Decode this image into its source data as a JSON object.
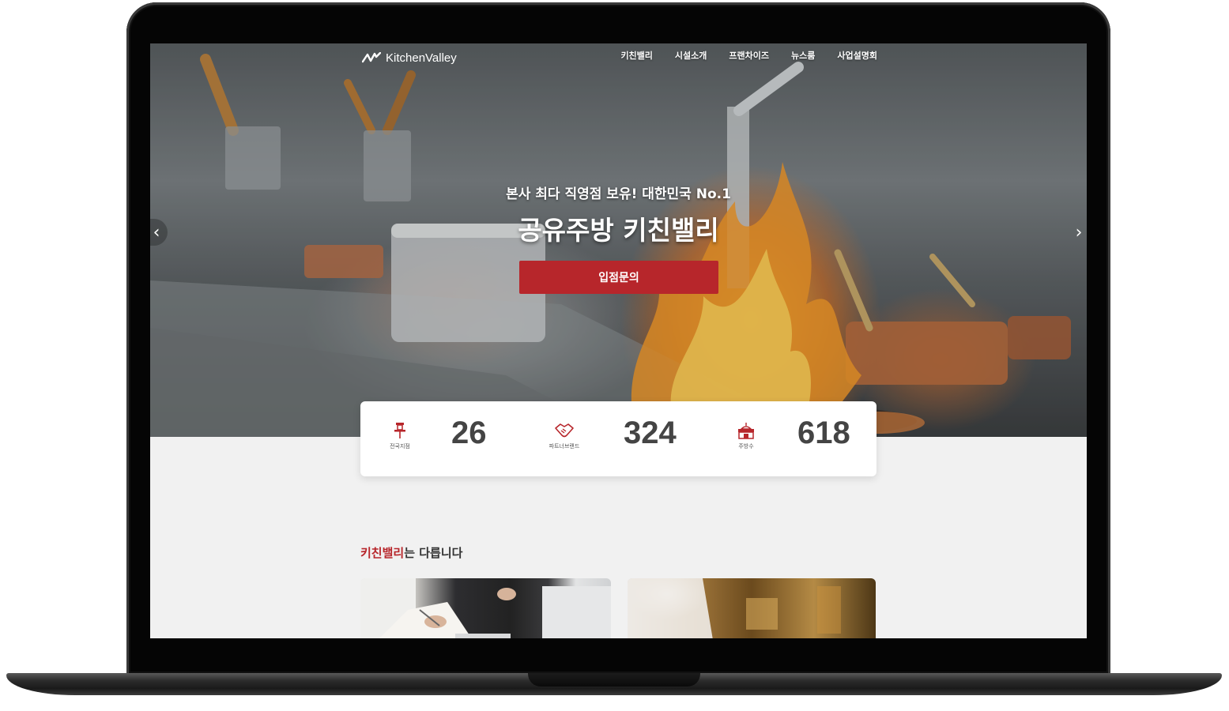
{
  "brand": {
    "name": "KitchenValley"
  },
  "nav": {
    "items": [
      {
        "label": "키친밸리"
      },
      {
        "label": "시설소개"
      },
      {
        "label": "프랜차이즈"
      },
      {
        "label": "뉴스룸"
      },
      {
        "label": "사업설명회"
      }
    ]
  },
  "hero": {
    "subtitle": "본사 최다 직영점 보유! 대한민국 No.1",
    "title": "공유주방 키친밸리",
    "cta_label": "입점문의",
    "prev_arrow": "‹",
    "next_arrow": "›"
  },
  "stats": [
    {
      "icon": "pin-icon",
      "label": "전국지점",
      "value": "26"
    },
    {
      "icon": "handshake-icon",
      "label": "파트너브랜드",
      "value": "324"
    },
    {
      "icon": "store-icon",
      "label": "주방수",
      "value": "618"
    }
  ],
  "section": {
    "title_highlight": "키친밸리",
    "title_rest": "는 다릅니다"
  },
  "colors": {
    "accent": "#b7262b",
    "background": "#f1f1f1",
    "stat_number": "#444444"
  }
}
